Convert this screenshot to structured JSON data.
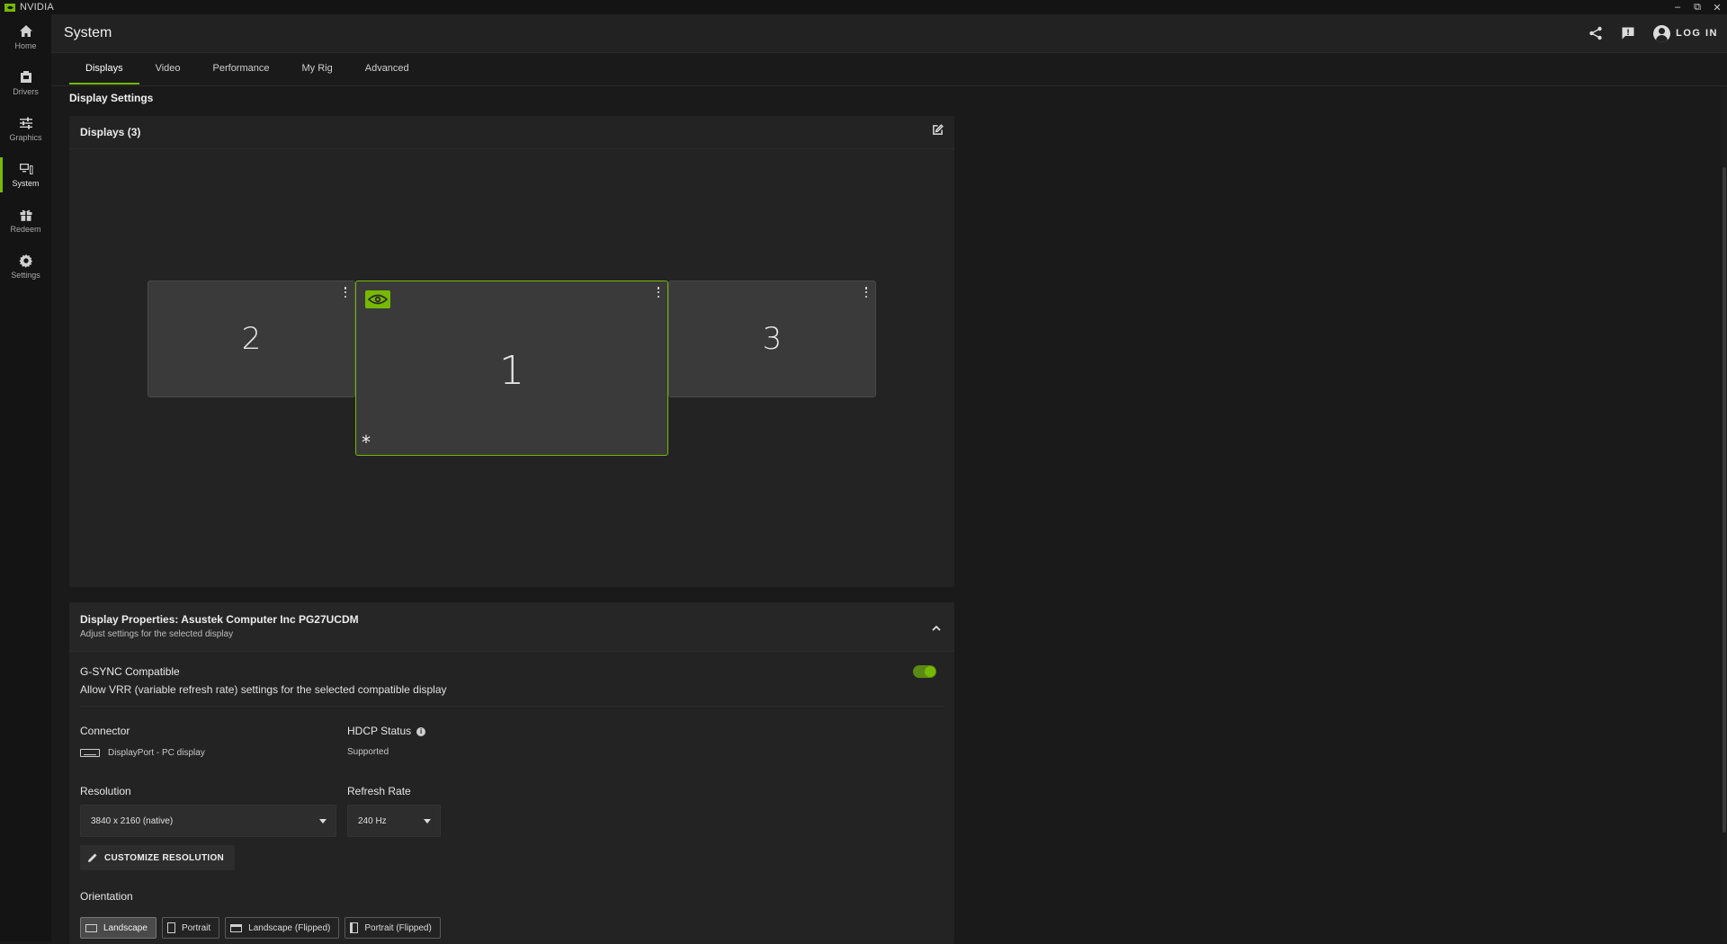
{
  "window": {
    "app_name": "NVIDIA",
    "controls": [
      "minimize",
      "restore",
      "close"
    ]
  },
  "sidebar": {
    "items": [
      {
        "label": "Home",
        "icon": "home-icon",
        "active": false
      },
      {
        "label": "Drivers",
        "icon": "drivers-icon",
        "active": false
      },
      {
        "label": "Graphics",
        "icon": "sliders-icon",
        "active": false
      },
      {
        "label": "System",
        "icon": "system-icon",
        "active": true
      },
      {
        "label": "Redeem",
        "icon": "gift-icon",
        "active": false
      },
      {
        "label": "Settings",
        "icon": "gear-icon",
        "active": false
      }
    ]
  },
  "header": {
    "title": "System",
    "login_label": "LOG IN"
  },
  "tabs": [
    {
      "label": "Displays",
      "active": true
    },
    {
      "label": "Video",
      "active": false
    },
    {
      "label": "Performance",
      "active": false
    },
    {
      "label": "My Rig",
      "active": false
    },
    {
      "label": "Advanced",
      "active": false
    }
  ],
  "display_settings": {
    "section_title": "Display Settings",
    "panel_title": "Displays (3)",
    "monitors": [
      {
        "number": "2",
        "selected": false
      },
      {
        "number": "1",
        "selected": true,
        "primary_marker": "*"
      },
      {
        "number": "3",
        "selected": false
      }
    ]
  },
  "properties": {
    "title": "Display Properties: Asustek Computer Inc PG27UCDM",
    "subtitle": "Adjust settings for the selected display",
    "gsync": {
      "title": "G-SYNC Compatible",
      "description": "Allow VRR (variable refresh rate) settings for the selected compatible display",
      "enabled": true
    },
    "connector": {
      "label": "Connector",
      "value": "DisplayPort - PC display"
    },
    "hdcp": {
      "label": "HDCP Status",
      "value": "Supported"
    },
    "resolution": {
      "label": "Resolution",
      "value": "3840 x 2160 (native)"
    },
    "refresh_rate": {
      "label": "Refresh Rate",
      "value": "240 Hz"
    },
    "customize_button": "CUSTOMIZE RESOLUTION",
    "orientation": {
      "label": "Orientation",
      "options": [
        "Landscape",
        "Portrait",
        "Landscape (Flipped)",
        "Portrait (Flipped)"
      ],
      "selected": "Landscape"
    }
  },
  "colors": {
    "accent": "#76b900",
    "background": "#1a1a1a",
    "panel": "#232323"
  }
}
